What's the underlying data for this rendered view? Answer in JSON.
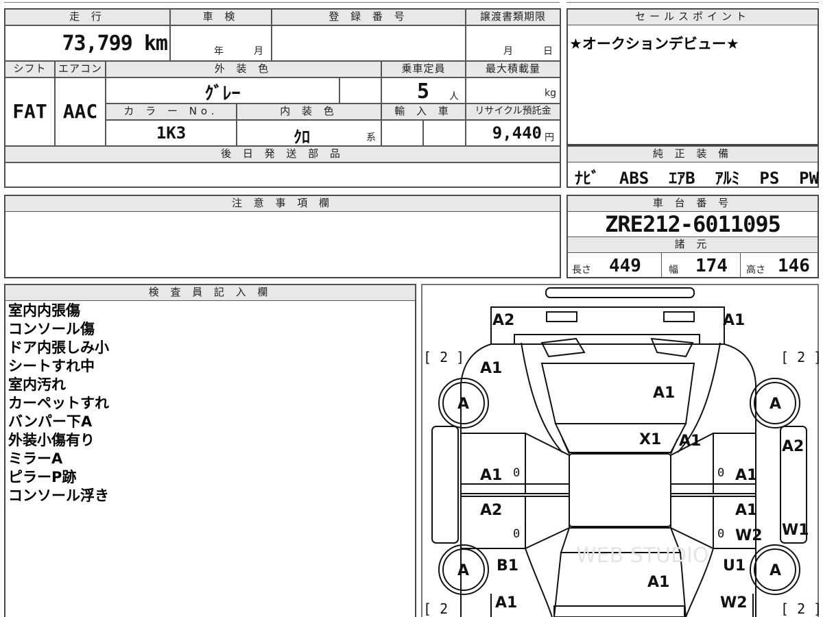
{
  "top": {
    "mileage_label": "走 行",
    "mileage_value": "73,799 km",
    "shaken_label": "車 検",
    "shaken_year": "年",
    "shaken_month": "月",
    "reg_label": "登 録 番 号",
    "transfer_label": "譲渡書類期限",
    "transfer_month": "月",
    "transfer_day": "日"
  },
  "spec": {
    "shift_label": "シフト",
    "shift_value": "FAT",
    "ac_label": "エアコン",
    "ac_value": "AAC",
    "exterior_label": "外 装 色",
    "exterior_value": "ｸﾞﾚｰ",
    "capacity_label": "乗車定員",
    "capacity_value": "5",
    "capacity_unit": "人",
    "load_label": "最大積載量",
    "load_unit": "kg",
    "color_no_label": "カ ラ ー No.",
    "color_no_value": "1K3",
    "interior_label": "内 装 色",
    "interior_value": "ｸﾛ",
    "interior_suffix": "系",
    "import_label": "輸 入 車",
    "recycle_label": "リサイクル預託金",
    "recycle_value": "9,440",
    "recycle_unit": "円",
    "later_parts_label": "後 日 発 送 部 品"
  },
  "sales": {
    "label": "セールスポイント",
    "text": "★オークションデビュー★"
  },
  "equipment": {
    "label": "純 正 装 備",
    "text": "ﾅﾋﾞ  ABS  ｴｱB  ｱﾙﾐ  PS  PW"
  },
  "caution": {
    "label": "注 意 事 項 欄"
  },
  "chassis": {
    "label": "車 台 番 号",
    "value": "ZRE212-6011095",
    "dims_label": "諸 元",
    "length_label": "長さ",
    "length_value": "449",
    "width_label": "幅",
    "width_value": "174",
    "height_label": "高さ",
    "height_value": "146"
  },
  "inspector": {
    "label": "検 査 員 記 入 欄",
    "notes": [
      "室内内張傷",
      "コンソール傷",
      "ドア内張しみ小",
      "シートすれ中",
      "室内汚れ",
      "カーペットすれ",
      "バンパー下A",
      "外装小傷有り",
      "ミラーA",
      "ピラーP跡",
      "コンソール浮き"
    ]
  },
  "diagram": {
    "tire_left_top": "[ 2 ]",
    "tire_right_top": "[ 2 ]",
    "tire_left_bottom": "[ 2",
    "tire_right_bottom": "[ 2 ]",
    "wheel_fl": "A",
    "wheel_fr": "A",
    "wheel_rl": "A",
    "wheel_rr": "A",
    "front_left_corner": "A2",
    "front_right_corner": "A1",
    "fender_left": "A1",
    "hood": "A1",
    "windshield": "X1",
    "pillar_right": "A1",
    "right_mirror_side": "A2",
    "front_door_left": "A1",
    "front_door_right": "A1",
    "rear_door_left": "A2",
    "rear_door_right": "A1",
    "rear_door_right_2": "W2",
    "rocker_right": "W1",
    "quarter_left": "B1",
    "quarter_right": "U1",
    "trunk": "A1",
    "rear_left": "A1",
    "rear_right": "W2",
    "zero_1": "0",
    "zero_2": "0",
    "zero_3": "0",
    "zero_4": "0",
    "watermark": "WEB STUDIO"
  }
}
